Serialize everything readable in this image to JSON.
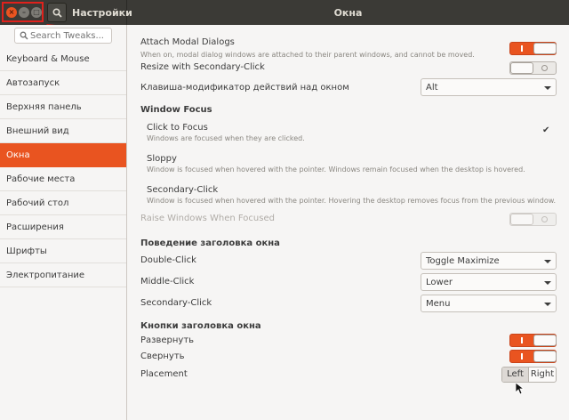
{
  "header": {
    "left_title": "Настройки",
    "main_title": "Окна"
  },
  "sidebar": {
    "search_placeholder": "Search Tweaks...",
    "items": [
      {
        "label": "Keyboard & Mouse",
        "active": false
      },
      {
        "label": "Автозапуск",
        "active": false
      },
      {
        "label": "Верхняя панель",
        "active": false
      },
      {
        "label": "Внешний вид",
        "active": false
      },
      {
        "label": "Окна",
        "active": true
      },
      {
        "label": "Рабочие места",
        "active": false
      },
      {
        "label": "Рабочий стол",
        "active": false
      },
      {
        "label": "Расширения",
        "active": false
      },
      {
        "label": "Шрифты",
        "active": false
      },
      {
        "label": "Электропитание",
        "active": false
      }
    ]
  },
  "main": {
    "attach_modal": {
      "label": "Attach Modal Dialogs",
      "desc": "When on, modal dialog windows are attached to their parent windows, and cannot be moved.",
      "on": true
    },
    "resize_secondary": {
      "label": "Resize with Secondary-Click",
      "on": false
    },
    "modifier": {
      "label": "Клавиша-модификатор действий над окном",
      "value": "Alt"
    },
    "window_focus": {
      "heading": "Window Focus",
      "click": {
        "label": "Click to Focus",
        "desc": "Windows are focused when they are clicked.",
        "checked": true,
        "check_glyph": "✔"
      },
      "sloppy": {
        "label": "Sloppy",
        "desc": "Window is focused when hovered with the pointer. Windows remain focused when the desktop is hovered."
      },
      "secondary": {
        "label": "Secondary-Click",
        "desc": "Window is focused when hovered with the pointer. Hovering the desktop removes focus from the previous window."
      }
    },
    "raise_windows": {
      "label": "Raise Windows When Focused",
      "on": false,
      "disabled": true
    },
    "titlebar_actions": {
      "heading": "Поведение заголовка окна",
      "double_click": {
        "label": "Double-Click",
        "value": "Toggle Maximize"
      },
      "middle_click": {
        "label": "Middle-Click",
        "value": "Lower"
      },
      "secondary_click": {
        "label": "Secondary-Click",
        "value": "Menu"
      }
    },
    "titlebar_buttons": {
      "heading": "Кнопки заголовка окна",
      "maximize": {
        "label": "Развернуть",
        "on": true
      },
      "minimize": {
        "label": "Свернуть",
        "on": true
      },
      "placement": {
        "label": "Placement",
        "left": "Left",
        "right": "Right",
        "selected": "Left"
      }
    }
  },
  "colors": {
    "accent": "#e95420",
    "headerbar": "#3b3a36",
    "annotation": "#e0211c"
  }
}
